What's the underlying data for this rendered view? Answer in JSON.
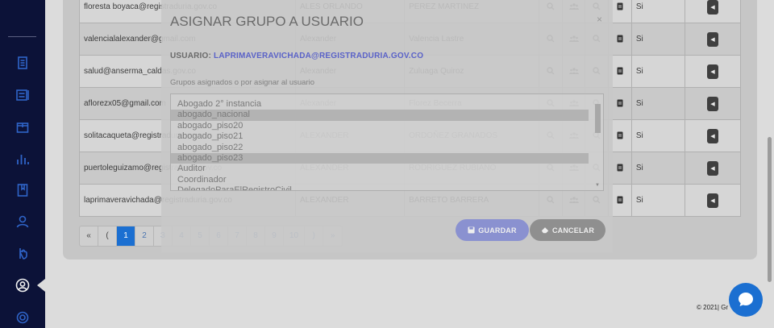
{
  "users": [
    {
      "email": "floresta boyaca@registraduria.gov.co",
      "name": "ALES ORLANDO",
      "last": "PEREZ MARTINEZ",
      "active": "Si"
    },
    {
      "email": "valencialalexander@gmail.com",
      "name": "Alexander",
      "last": "Valencia Lastre",
      "active": "Si"
    },
    {
      "email": "salud@anserma_caldas.gov.co",
      "name": "Alexander",
      "last": "Zuluaga Quiroz",
      "active": "Si"
    },
    {
      "email": "aflorezx05@gmail.com",
      "name": "Alexander",
      "last": "Florez Becerra",
      "active": "Si"
    },
    {
      "email": "solitacaqueta@registraduria.gov.co",
      "name": "ALEXANDER",
      "last": "ORDOÑEZ GRANADOS",
      "active": "Si"
    },
    {
      "email": "puertoleguizamo@registraduria.gov.co",
      "name": "ALEXANDER",
      "last": "RODRIGUEZ RUBIANO",
      "active": "Si"
    },
    {
      "email": "laprimaveravichada@registraduria.gov.co",
      "name": "ALEXANDER",
      "last": "BARRETO BARRERA",
      "active": "Si"
    }
  ],
  "pagination": {
    "first": "«",
    "prev": "(",
    "pages": [
      "1",
      "2",
      "3",
      "4",
      "5",
      "6",
      "7",
      "8",
      "9",
      "10"
    ],
    "next": ")",
    "last": "»",
    "active_page": "1"
  },
  "footer": {
    "copyright": "© 2021| Gr"
  },
  "modal": {
    "title": "ASIGNAR GRUPO A USUARIO",
    "close": "×",
    "user_label": "USUARIO:",
    "user_value": "LAPRIMAVERAVICHADA@REGISTRADURIA.GOV.CO",
    "subtitle": "Grupos asignados o por asignar al usuario",
    "groups": [
      {
        "label": "Abogado 2° instancia",
        "selected": false
      },
      {
        "label": "abogado_nacional",
        "selected": true
      },
      {
        "label": "abogado_piso20",
        "selected": false
      },
      {
        "label": "abogado_piso21",
        "selected": false
      },
      {
        "label": "abogado_piso22",
        "selected": false
      },
      {
        "label": "abogado_piso23",
        "selected": true
      },
      {
        "label": "Auditor",
        "selected": false
      },
      {
        "label": "Coordinador",
        "selected": false
      },
      {
        "label": "DelegadoParaElRegistroCivil",
        "selected": false
      }
    ],
    "save_label": "GUARDAR",
    "cancel_label": "CANCELAR"
  },
  "colors": {
    "sidebar": "#0c1238",
    "accent": "#1b6fd1",
    "save_button": "#8a91d0",
    "cancel_button": "#8f8f8f",
    "user_value": "#5a62c8"
  },
  "sidebar_icons": [
    "document-icon",
    "list-icon",
    "box-icon",
    "bar-chart-icon",
    "book-icon",
    "user-icon",
    "hand-icon",
    "profile-circle-icon",
    "settings-icon"
  ]
}
